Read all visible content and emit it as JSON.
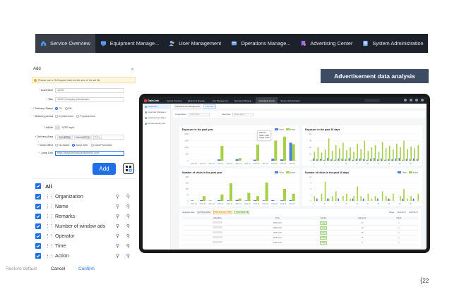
{
  "topnav": {
    "tabs": [
      {
        "label": "Service Overview",
        "icon": "home-icon",
        "active": true
      },
      {
        "label": "Equipment Manage...",
        "icon": "monitor-icon"
      },
      {
        "label": "User Management",
        "icon": "users-icon"
      },
      {
        "label": "Operations Manage...",
        "icon": "operations-icon"
      },
      {
        "label": "Advertising Center",
        "icon": "bookmark-icon"
      },
      {
        "label": "System Administration",
        "icon": "settings-doc-icon"
      }
    ]
  },
  "add_dialog": {
    "title": "Add",
    "notice": "Please use a 16:9 aspect ratio for the size of the ad file.",
    "fields": {
      "advertiser_label": "Advertiser",
      "advertiser_value": "JUSU",
      "title_label": "Title",
      "title_value": "JUSU Company Introduction",
      "delivery_status_label": "Delivery Status",
      "delivery_status_options": [
        "TV",
        "PB"
      ],
      "delivery_period_label": "Delivery period",
      "delivery_period_options": [
        "Ci placement",
        "T1 placement"
      ],
      "ad_file_label": "Ad file",
      "ad_file_value": "JUTR.mp4",
      "delivery_area_label": "Delivery Area",
      "delivery_area_tags": [
        "北京(朝阳区)",
        "Mianki(闵行区)",
        "+ 3 ..."
      ],
      "click_effect_label": "Click effect",
      "click_effect_options": [
        "No Action",
        "Jump Web",
        "Card Promotion"
      ],
      "jump_link_label": "Jump Link",
      "jump_link_value": "https://www.jeosaoucerilyolndns.com/"
    },
    "add_button": "Add"
  },
  "column_settings": {
    "all_label": "All",
    "columns": [
      "Organization",
      "Name",
      "Remarks",
      "Number of window ads",
      "Operator",
      "Time",
      "Action"
    ],
    "restore_label": "Restore default",
    "cancel_label": "Cancel",
    "confirm_label": "Confirm"
  },
  "badge": "Advertisement data analysis",
  "app": {
    "logo": "GainLink",
    "nav_tabs": [
      "Service Overview",
      "Equipment Manage...",
      "User Management",
      "Operations Manage...",
      "Advertising Center",
      "System Administration"
    ],
    "sidebar": [
      "Advertisers",
      "Advertiser Managem...",
      "Advertisement Mana...",
      "Window display ads..."
    ],
    "breadcrumb": [
      "Advertisement Management",
      "Advertisers"
    ],
    "filter": {
      "org_label": "Organization",
      "org_value": "JUSU (Goo)",
      "adv_label": "Advertiser",
      "adv_placeholder": "Please select"
    },
    "cards": {
      "exp_year_title": "Exposure in the past year",
      "exp_30_title": "Exposure in the past 30 days",
      "clk_year_title": "Number of clicks in the past year",
      "clk_30_title": "Number of clicks in the past 30 days",
      "legend_video": "Video",
      "legend_image": "Image"
    },
    "tooltip": {
      "date": "2024-07",
      "video_label": "Video",
      "video_val": "1,344",
      "image_label": "Image",
      "image_val": "1,234"
    },
    "table": {
      "tools": [
        "Aggregate Data",
        "Ad Name Data",
        "Total Exposure: 1551",
        "Total Clicks: 66"
      ],
      "range_label": "Range",
      "range_values": [
        "2024-04-17",
        "2024-05-17"
      ],
      "headers": [
        "Advertiser",
        "Time",
        "Ad type",
        "Exposure",
        "Clicks"
      ],
      "rows": [
        {
          "time": "2024-04-17",
          "type": "Image",
          "exposure": "47",
          "clicks": "1"
        },
        {
          "time": "2024-04-17",
          "type": "Image",
          "exposure": "19",
          "clicks": "1"
        },
        {
          "time": "2024-04-17",
          "type": "Image",
          "exposure": "45",
          "clicks": "1"
        },
        {
          "time": "2024-04-17",
          "type": "Image",
          "exposure": "41",
          "clicks": "1"
        },
        {
          "time": "2024-04-17",
          "type": "Image",
          "exposure": "8",
          "clicks": "1"
        }
      ]
    }
  },
  "colors": {
    "accent": "#1e6fe8",
    "nav": "#1d2129",
    "bar_video": "#4a7de0",
    "bar_image": "#a6cf4a",
    "badge": "#3d4b63"
  },
  "page_number": "22",
  "chart_data": [
    {
      "type": "bar",
      "title": "Exposure in the past year",
      "categories": [
        "2023-08",
        "2023-09",
        "2023-10",
        "2023-11",
        "2023-12",
        "2024-01",
        "2024-02",
        "2024-03",
        "2024-04",
        "2024-05",
        "2024-06",
        "2024-07"
      ],
      "ylim": [
        0,
        2000
      ],
      "series": [
        {
          "name": "Video",
          "values": [
            0,
            0,
            0,
            100,
            0,
            120,
            0,
            80,
            0,
            150,
            100,
            1344
          ]
        },
        {
          "name": "Image",
          "values": [
            0,
            0,
            0,
            1100,
            0,
            200,
            0,
            1200,
            0,
            1500,
            1800,
            1234
          ]
        }
      ]
    },
    {
      "type": "bar",
      "title": "Exposure in the past 30 days",
      "categories": [
        "1",
        "2",
        "3",
        "4",
        "5",
        "6",
        "7",
        "8",
        "9",
        "10",
        "11",
        "12",
        "13",
        "14",
        "15",
        "16",
        "17",
        "18",
        "19",
        "20",
        "21",
        "22",
        "23",
        "24",
        "25",
        "26",
        "27",
        "28",
        "29",
        "30"
      ],
      "ylim": [
        0,
        60
      ],
      "series": [
        {
          "name": "Video",
          "values": [
            5,
            3,
            4,
            2,
            6,
            3,
            2,
            5,
            4,
            3,
            6,
            2,
            4,
            5,
            3,
            2,
            4,
            6,
            3,
            5,
            2,
            4,
            3,
            5,
            6,
            2,
            4,
            3,
            5,
            4
          ]
        },
        {
          "name": "Image",
          "values": [
            20,
            30,
            18,
            25,
            50,
            22,
            35,
            28,
            40,
            24,
            30,
            20,
            38,
            26,
            45,
            22,
            30,
            35,
            20,
            42,
            28,
            33,
            25,
            38,
            30,
            45,
            26,
            32,
            28,
            35
          ]
        }
      ]
    },
    {
      "type": "bar",
      "title": "Number of clicks in the past year",
      "categories": [
        "2023-08",
        "2023-09",
        "2023-10",
        "2023-11",
        "2023-12",
        "2024-01",
        "2024-02",
        "2024-03",
        "2024-04",
        "2024-05",
        "2024-06",
        "2024-07"
      ],
      "ylim": [
        0,
        300
      ],
      "series": [
        {
          "name": "Video",
          "values": [
            5,
            8,
            4,
            10,
            6,
            12,
            5,
            8,
            6,
            10,
            7,
            9
          ]
        },
        {
          "name": "Image",
          "values": [
            0,
            60,
            0,
            80,
            220,
            30,
            100,
            60,
            230,
            0,
            150,
            90
          ]
        }
      ]
    },
    {
      "type": "bar",
      "title": "Number of clicks in the past 30 days",
      "categories": [
        "1",
        "2",
        "3",
        "4",
        "5",
        "6",
        "7",
        "8",
        "9",
        "10",
        "11",
        "12",
        "13",
        "14",
        "15",
        "16",
        "17",
        "18",
        "19",
        "20",
        "21",
        "22",
        "23",
        "24",
        "25",
        "26",
        "27",
        "28",
        "29",
        "30"
      ],
      "ylim": [
        0,
        10
      ],
      "series": [
        {
          "name": "Video",
          "values": [
            0,
            1,
            0,
            0,
            1,
            0,
            0,
            1,
            0,
            0,
            0,
            1,
            0,
            0,
            1,
            0,
            0,
            0,
            1,
            0,
            0,
            1,
            0,
            0,
            0,
            1,
            0,
            0,
            1,
            0
          ]
        },
        {
          "name": "Image",
          "values": [
            2,
            0,
            3,
            8,
            1,
            2,
            4,
            0,
            2,
            3,
            1,
            2,
            6,
            2,
            0,
            3,
            1,
            2,
            0,
            4,
            2,
            1,
            3,
            0,
            2,
            5,
            1,
            2,
            0,
            3
          ]
        }
      ]
    }
  ]
}
